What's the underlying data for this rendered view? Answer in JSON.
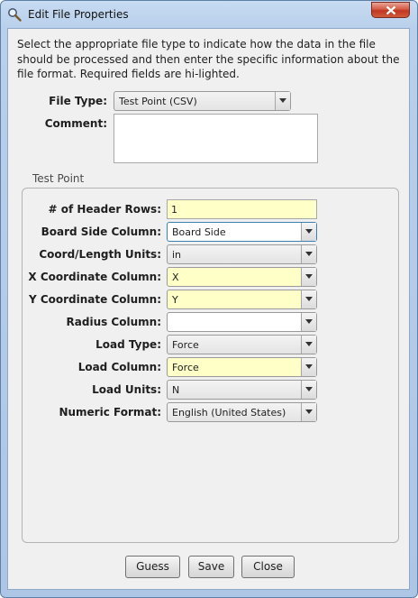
{
  "window": {
    "title": "Edit File Properties",
    "icon": "magnifier-icon",
    "close_icon": "close-icon"
  },
  "intro_text": "Select the appropriate file type to indicate how the data in the file should be processed and then enter the specific information about the file format. Required fields are hi-lighted.",
  "file_type": {
    "label": "File Type:",
    "value": "Test Point (CSV)"
  },
  "comment": {
    "label": "Comment:",
    "value": ""
  },
  "group": {
    "title": "Test Point",
    "fields": [
      {
        "label": "# of Header Rows:",
        "value": "1",
        "kind": "text",
        "required": true
      },
      {
        "label": "Board Side Column:",
        "value": "Board Side",
        "kind": "editable-combo",
        "required": false
      },
      {
        "label": "Coord/Length Units:",
        "value": "in",
        "kind": "combo",
        "required": false
      },
      {
        "label": "X Coordinate Column:",
        "value": "X",
        "kind": "editable-combo",
        "required": true
      },
      {
        "label": "Y Coordinate Column:",
        "value": "Y",
        "kind": "editable-combo",
        "required": true
      },
      {
        "label": "Radius Column:",
        "value": "",
        "kind": "editable-combo",
        "required": false
      },
      {
        "label": "Load Type:",
        "value": "Force",
        "kind": "combo",
        "required": false
      },
      {
        "label": "Load Column:",
        "value": "Force",
        "kind": "editable-combo",
        "required": true
      },
      {
        "label": "Load Units:",
        "value": "N",
        "kind": "combo",
        "required": false
      },
      {
        "label": "Numeric Format:",
        "value": "English (United States)",
        "kind": "combo",
        "required": false
      }
    ]
  },
  "buttons": {
    "guess": "Guess",
    "save": "Save",
    "close": "Close"
  },
  "colors": {
    "required_highlight": "#ffffc8",
    "title_bar": "#b9d0ec",
    "close_button": "#c2361f"
  }
}
